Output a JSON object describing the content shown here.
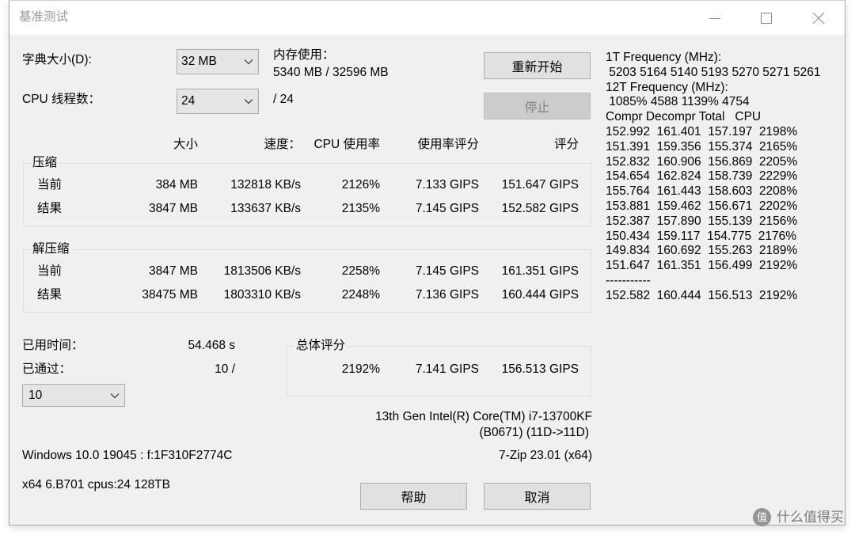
{
  "window": {
    "title": "基准测试",
    "icons": {
      "minimize": "minimize-icon",
      "maximize": "maximize-icon",
      "close": "close-icon"
    }
  },
  "settings": {
    "dictionary": {
      "label": "字典大小(D):",
      "value": "32 MB"
    },
    "memory": {
      "label": "内存使用：",
      "value": "5340 MB / 32596 MB"
    },
    "threads": {
      "label": "CPU 线程数：",
      "value": "24",
      "max": "/ 24"
    }
  },
  "buttons": {
    "restart": "重新开始",
    "stop": "停止",
    "help": "帮助",
    "cancel": "取消"
  },
  "columns": {
    "size": "大小",
    "speed": "速度：",
    "cpu_usage": "CPU 使用率",
    "rating_per_usage": "使用率评分",
    "rating": "评分"
  },
  "compression": {
    "label": "压缩",
    "rows": [
      {
        "label": "当前",
        "size": "384 MB",
        "speed": "132818 KB/s",
        "cpu_usage": "2126%",
        "rating_per_usage": "7.133 GIPS",
        "rating": "151.647 GIPS"
      },
      {
        "label": "结果",
        "size": "3847 MB",
        "speed": "133637 KB/s",
        "cpu_usage": "2135%",
        "rating_per_usage": "7.145 GIPS",
        "rating": "152.582 GIPS"
      }
    ]
  },
  "decompression": {
    "label": "解压缩",
    "rows": [
      {
        "label": "当前",
        "size": "3847 MB",
        "speed": "1813506 KB/s",
        "cpu_usage": "2258%",
        "rating_per_usage": "7.145 GIPS",
        "rating": "161.351 GIPS"
      },
      {
        "label": "结果",
        "size": "38475 MB",
        "speed": "1803310 KB/s",
        "cpu_usage": "2248%",
        "rating_per_usage": "7.136 GIPS",
        "rating": "160.444 GIPS"
      }
    ]
  },
  "elapsed": {
    "label": "已用时间：",
    "value": "54.468 s"
  },
  "passes": {
    "label": "已通过：",
    "value": "10 /",
    "selected": "10"
  },
  "total": {
    "label": "总体评分",
    "cpu_usage": "2192%",
    "rating_per_usage": "7.141 GIPS",
    "rating": "156.513 GIPS"
  },
  "system": {
    "cpu_name": "13th Gen Intel(R) Core(TM) i7-13700KF",
    "cpu_id": "(B0671) (11D->11D)",
    "os": "Windows 10.0 19045 : f:1F310F2774C",
    "version": "7-Zip 23.01 (x64)",
    "arch": "x64 6.B701 cpus:24 128TB"
  },
  "log": {
    "lines": [
      "1T Frequency (MHz):",
      " 5203 5164 5140 5193 5270 5271 5261",
      "12T Frequency (MHz):",
      " 1085% 4588 1139% 4754",
      "Compr Decompr Total   CPU",
      "152.992  161.401  157.197  2198%",
      "151.391  159.356  155.374  2165%",
      "152.832  160.906  156.869  2205%",
      "154.654  162.824  158.739  2229%",
      "155.764  161.443  158.603  2208%",
      "153.881  159.462  156.671  2202%",
      "152.387  157.890  155.139  2156%",
      "150.434  159.117  154.775  2176%",
      "149.834  160.692  155.263  2189%",
      "151.647  161.351  156.499  2192%",
      "-----------",
      "152.582  160.444  156.513  2192%"
    ]
  },
  "watermark": {
    "logo": "值",
    "text": "什么值得买"
  },
  "icons": {
    "dropdown": "chevron-down-icon"
  },
  "colors": {
    "window_bg": "#f0f0f0",
    "titlebar_bg": "#ffffff",
    "title_text": "#999999",
    "button_bg": "#e1e1e1",
    "button_border": "#adadad",
    "disabled_bg": "#cccccc",
    "disabled_border": "#bfbfbf",
    "disabled_text": "#838383",
    "combo_bg": "#e5e5e5",
    "combo_border": "#acacac",
    "group_border": "#dcdcdc",
    "text": "#000000",
    "watermark": "#7a7a7a"
  }
}
